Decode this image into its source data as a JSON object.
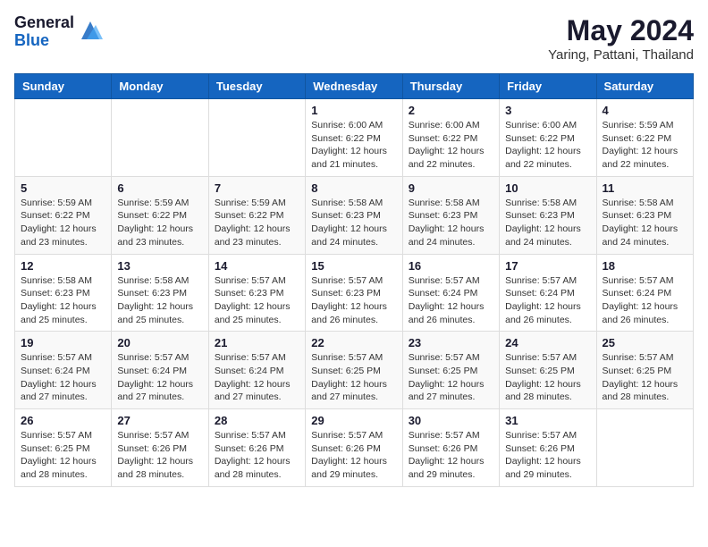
{
  "header": {
    "logo_general": "General",
    "logo_blue": "Blue",
    "month_year": "May 2024",
    "location": "Yaring, Pattani, Thailand"
  },
  "weekdays": [
    "Sunday",
    "Monday",
    "Tuesday",
    "Wednesday",
    "Thursday",
    "Friday",
    "Saturday"
  ],
  "weeks": [
    [
      {
        "day": "",
        "info": ""
      },
      {
        "day": "",
        "info": ""
      },
      {
        "day": "",
        "info": ""
      },
      {
        "day": "1",
        "info": "Sunrise: 6:00 AM\nSunset: 6:22 PM\nDaylight: 12 hours\nand 21 minutes."
      },
      {
        "day": "2",
        "info": "Sunrise: 6:00 AM\nSunset: 6:22 PM\nDaylight: 12 hours\nand 22 minutes."
      },
      {
        "day": "3",
        "info": "Sunrise: 6:00 AM\nSunset: 6:22 PM\nDaylight: 12 hours\nand 22 minutes."
      },
      {
        "day": "4",
        "info": "Sunrise: 5:59 AM\nSunset: 6:22 PM\nDaylight: 12 hours\nand 22 minutes."
      }
    ],
    [
      {
        "day": "5",
        "info": "Sunrise: 5:59 AM\nSunset: 6:22 PM\nDaylight: 12 hours\nand 23 minutes."
      },
      {
        "day": "6",
        "info": "Sunrise: 5:59 AM\nSunset: 6:22 PM\nDaylight: 12 hours\nand 23 minutes."
      },
      {
        "day": "7",
        "info": "Sunrise: 5:59 AM\nSunset: 6:22 PM\nDaylight: 12 hours\nand 23 minutes."
      },
      {
        "day": "8",
        "info": "Sunrise: 5:58 AM\nSunset: 6:23 PM\nDaylight: 12 hours\nand 24 minutes."
      },
      {
        "day": "9",
        "info": "Sunrise: 5:58 AM\nSunset: 6:23 PM\nDaylight: 12 hours\nand 24 minutes."
      },
      {
        "day": "10",
        "info": "Sunrise: 5:58 AM\nSunset: 6:23 PM\nDaylight: 12 hours\nand 24 minutes."
      },
      {
        "day": "11",
        "info": "Sunrise: 5:58 AM\nSunset: 6:23 PM\nDaylight: 12 hours\nand 24 minutes."
      }
    ],
    [
      {
        "day": "12",
        "info": "Sunrise: 5:58 AM\nSunset: 6:23 PM\nDaylight: 12 hours\nand 25 minutes."
      },
      {
        "day": "13",
        "info": "Sunrise: 5:58 AM\nSunset: 6:23 PM\nDaylight: 12 hours\nand 25 minutes."
      },
      {
        "day": "14",
        "info": "Sunrise: 5:57 AM\nSunset: 6:23 PM\nDaylight: 12 hours\nand 25 minutes."
      },
      {
        "day": "15",
        "info": "Sunrise: 5:57 AM\nSunset: 6:23 PM\nDaylight: 12 hours\nand 26 minutes."
      },
      {
        "day": "16",
        "info": "Sunrise: 5:57 AM\nSunset: 6:24 PM\nDaylight: 12 hours\nand 26 minutes."
      },
      {
        "day": "17",
        "info": "Sunrise: 5:57 AM\nSunset: 6:24 PM\nDaylight: 12 hours\nand 26 minutes."
      },
      {
        "day": "18",
        "info": "Sunrise: 5:57 AM\nSunset: 6:24 PM\nDaylight: 12 hours\nand 26 minutes."
      }
    ],
    [
      {
        "day": "19",
        "info": "Sunrise: 5:57 AM\nSunset: 6:24 PM\nDaylight: 12 hours\nand 27 minutes."
      },
      {
        "day": "20",
        "info": "Sunrise: 5:57 AM\nSunset: 6:24 PM\nDaylight: 12 hours\nand 27 minutes."
      },
      {
        "day": "21",
        "info": "Sunrise: 5:57 AM\nSunset: 6:24 PM\nDaylight: 12 hours\nand 27 minutes."
      },
      {
        "day": "22",
        "info": "Sunrise: 5:57 AM\nSunset: 6:25 PM\nDaylight: 12 hours\nand 27 minutes."
      },
      {
        "day": "23",
        "info": "Sunrise: 5:57 AM\nSunset: 6:25 PM\nDaylight: 12 hours\nand 27 minutes."
      },
      {
        "day": "24",
        "info": "Sunrise: 5:57 AM\nSunset: 6:25 PM\nDaylight: 12 hours\nand 28 minutes."
      },
      {
        "day": "25",
        "info": "Sunrise: 5:57 AM\nSunset: 6:25 PM\nDaylight: 12 hours\nand 28 minutes."
      }
    ],
    [
      {
        "day": "26",
        "info": "Sunrise: 5:57 AM\nSunset: 6:25 PM\nDaylight: 12 hours\nand 28 minutes."
      },
      {
        "day": "27",
        "info": "Sunrise: 5:57 AM\nSunset: 6:26 PM\nDaylight: 12 hours\nand 28 minutes."
      },
      {
        "day": "28",
        "info": "Sunrise: 5:57 AM\nSunset: 6:26 PM\nDaylight: 12 hours\nand 28 minutes."
      },
      {
        "day": "29",
        "info": "Sunrise: 5:57 AM\nSunset: 6:26 PM\nDaylight: 12 hours\nand 29 minutes."
      },
      {
        "day": "30",
        "info": "Sunrise: 5:57 AM\nSunset: 6:26 PM\nDaylight: 12 hours\nand 29 minutes."
      },
      {
        "day": "31",
        "info": "Sunrise: 5:57 AM\nSunset: 6:26 PM\nDaylight: 12 hours\nand 29 minutes."
      },
      {
        "day": "",
        "info": ""
      }
    ]
  ]
}
